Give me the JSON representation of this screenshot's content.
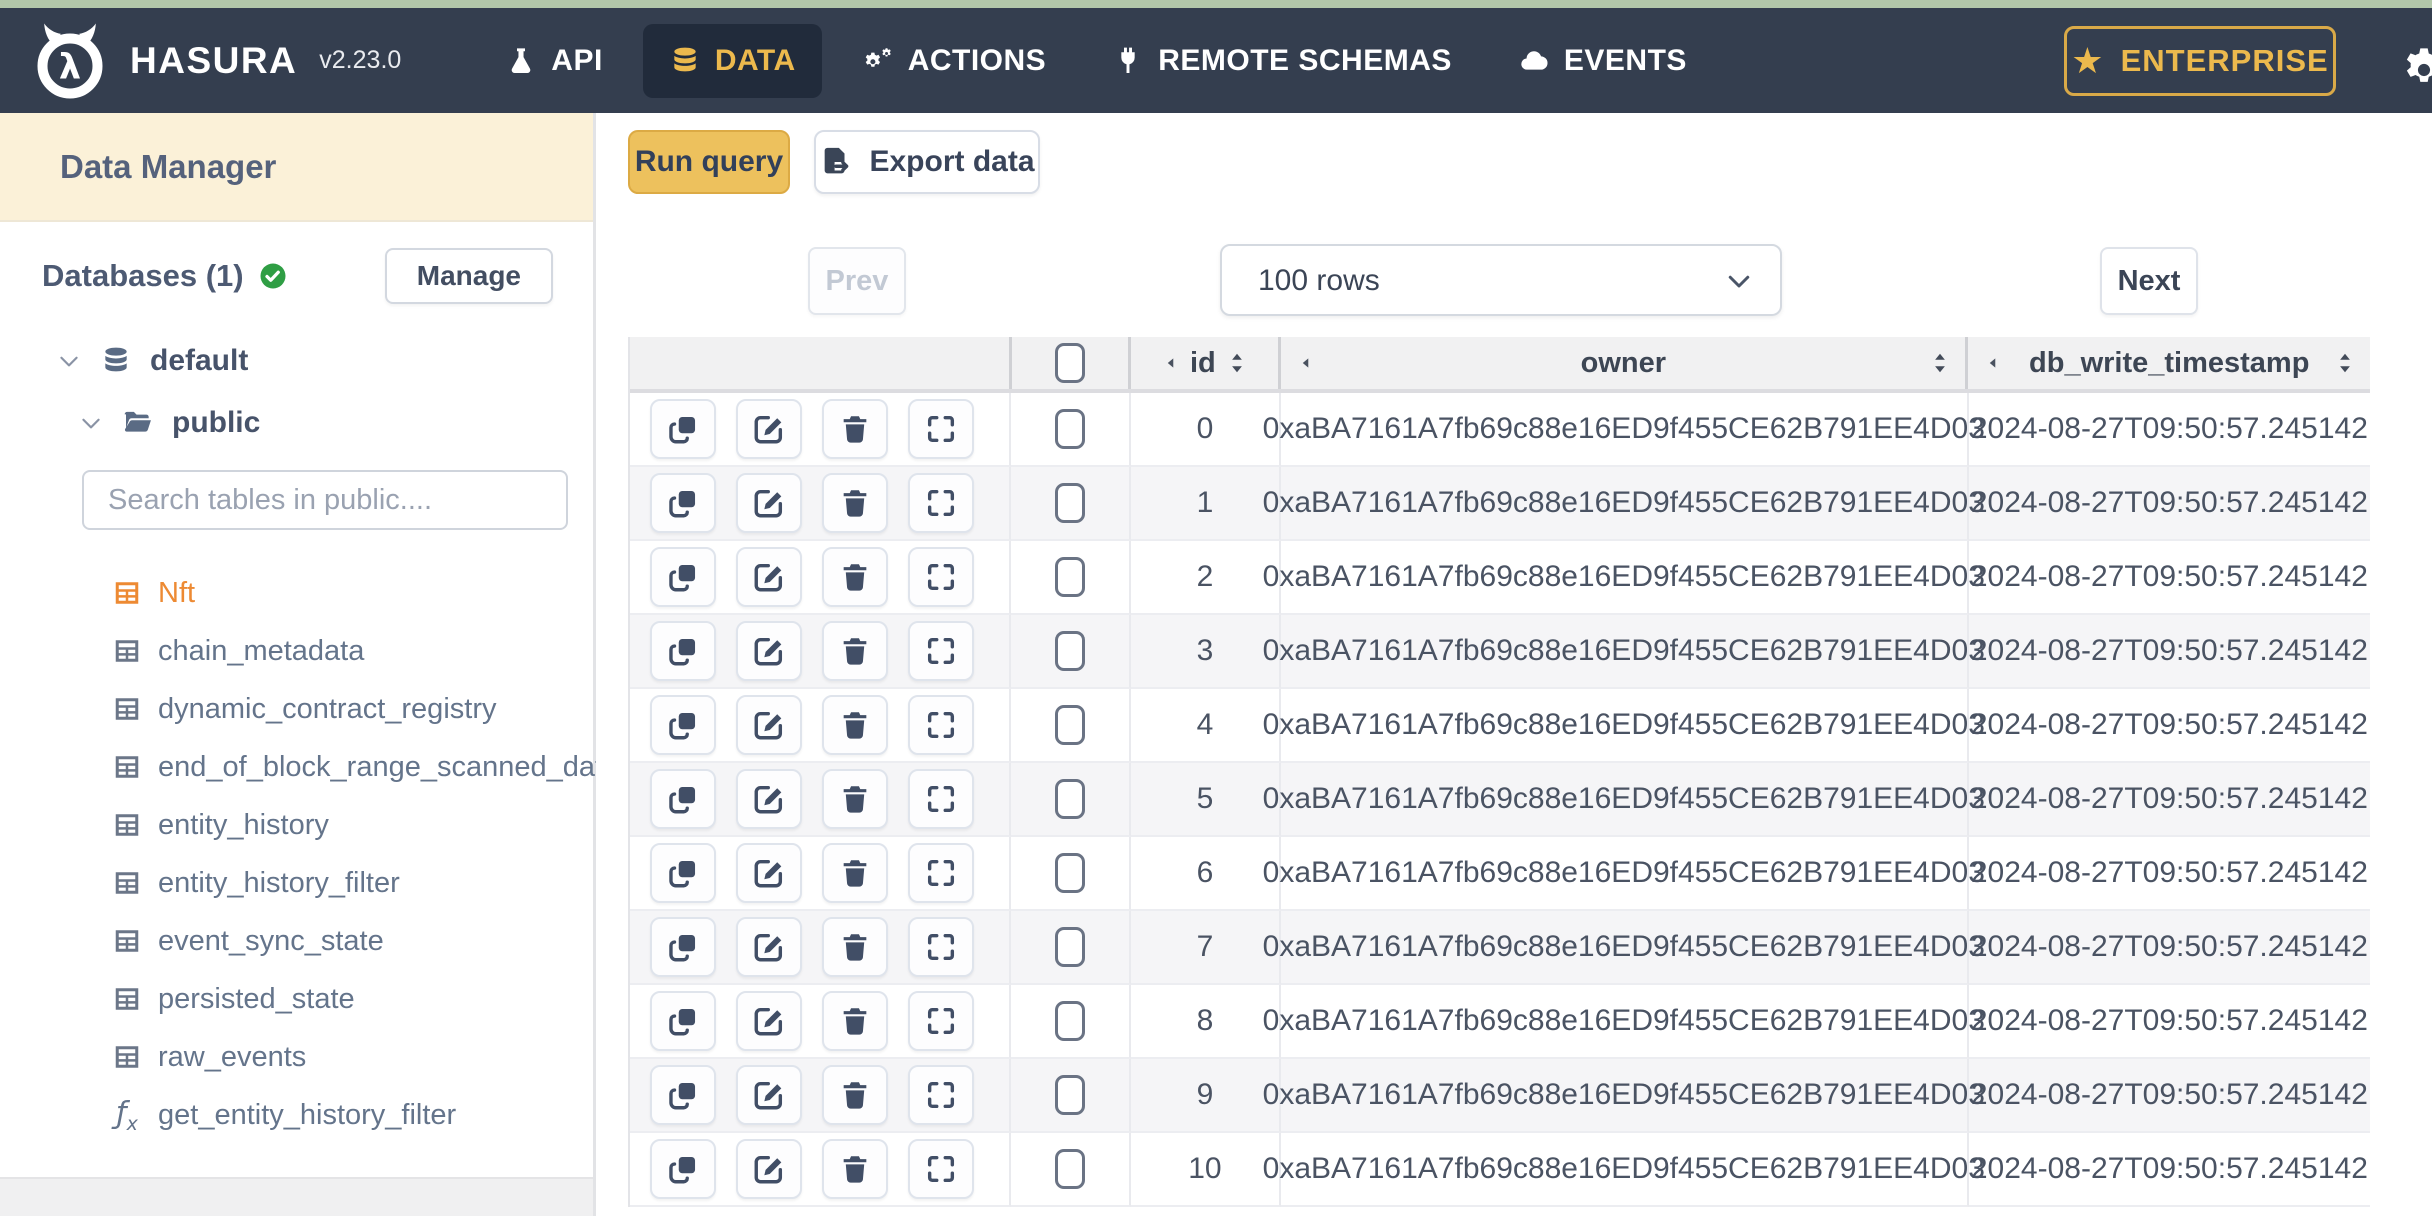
{
  "topbar": {
    "brand": "HASURA",
    "version": "v2.23.0",
    "nav": [
      {
        "label": "API",
        "icon": "flask-icon",
        "active": false
      },
      {
        "label": "DATA",
        "icon": "database-icon",
        "active": true
      },
      {
        "label": "ACTIONS",
        "icon": "gears-icon",
        "active": false
      },
      {
        "label": "REMOTE SCHEMAS",
        "icon": "plug-icon",
        "active": false
      },
      {
        "label": "EVENTS",
        "icon": "cloud-icon",
        "active": false
      }
    ],
    "enterprise_label": "ENTERPRISE"
  },
  "sidebar": {
    "title": "Data Manager",
    "databases_label": "Databases (1)",
    "manage_label": "Manage",
    "tree": {
      "database": "default",
      "schema": "public"
    },
    "search_placeholder": "Search tables in public....",
    "tables": [
      {
        "label": "Nft",
        "icon": "table-icon",
        "active": true
      },
      {
        "label": "chain_metadata",
        "icon": "table-icon",
        "active": false
      },
      {
        "label": "dynamic_contract_registry",
        "icon": "table-icon",
        "active": false
      },
      {
        "label": "end_of_block_range_scanned_data",
        "icon": "table-icon",
        "active": false
      },
      {
        "label": "entity_history",
        "icon": "table-icon",
        "active": false
      },
      {
        "label": "entity_history_filter",
        "icon": "table-icon",
        "active": false
      },
      {
        "label": "event_sync_state",
        "icon": "table-icon",
        "active": false
      },
      {
        "label": "persisted_state",
        "icon": "table-icon",
        "active": false
      },
      {
        "label": "raw_events",
        "icon": "table-icon",
        "active": false
      },
      {
        "label": "get_entity_history_filter",
        "icon": "function-icon",
        "active": false
      }
    ]
  },
  "toolbar": {
    "run_query_label": "Run query",
    "export_data_label": "Export data"
  },
  "pagination": {
    "prev_label": "Prev",
    "page_size": "100 rows",
    "next_label": "Next"
  },
  "table": {
    "columns": [
      "id",
      "owner",
      "db_write_timestamp"
    ],
    "rows": [
      {
        "id": "0",
        "owner": "0xaBA7161A7fb69c88e16ED9f455CE62B791EE4D03",
        "db_write_timestamp": "2024-08-27T09:50:57.245142"
      },
      {
        "id": "1",
        "owner": "0xaBA7161A7fb69c88e16ED9f455CE62B791EE4D03",
        "db_write_timestamp": "2024-08-27T09:50:57.245142"
      },
      {
        "id": "2",
        "owner": "0xaBA7161A7fb69c88e16ED9f455CE62B791EE4D03",
        "db_write_timestamp": "2024-08-27T09:50:57.245142"
      },
      {
        "id": "3",
        "owner": "0xaBA7161A7fb69c88e16ED9f455CE62B791EE4D03",
        "db_write_timestamp": "2024-08-27T09:50:57.245142"
      },
      {
        "id": "4",
        "owner": "0xaBA7161A7fb69c88e16ED9f455CE62B791EE4D03",
        "db_write_timestamp": "2024-08-27T09:50:57.245142"
      },
      {
        "id": "5",
        "owner": "0xaBA7161A7fb69c88e16ED9f455CE62B791EE4D03",
        "db_write_timestamp": "2024-08-27T09:50:57.245142"
      },
      {
        "id": "6",
        "owner": "0xaBA7161A7fb69c88e16ED9f455CE62B791EE4D03",
        "db_write_timestamp": "2024-08-27T09:50:57.245142"
      },
      {
        "id": "7",
        "owner": "0xaBA7161A7fb69c88e16ED9f455CE62B791EE4D03",
        "db_write_timestamp": "2024-08-27T09:50:57.245142"
      },
      {
        "id": "8",
        "owner": "0xaBA7161A7fb69c88e16ED9f455CE62B791EE4D03",
        "db_write_timestamp": "2024-08-27T09:50:57.245142"
      },
      {
        "id": "9",
        "owner": "0xaBA7161A7fb69c88e16ED9f455CE62B791EE4D03",
        "db_write_timestamp": "2024-08-27T09:50:57.245142"
      },
      {
        "id": "10",
        "owner": "0xaBA7161A7fb69c88e16ED9f455CE62B791EE4D03",
        "db_write_timestamp": "2024-08-27T09:50:57.245142"
      }
    ]
  },
  "colors": {
    "top_strip": "#b2c7aa",
    "navbar_bg": "#343e4f",
    "active_nav_bg": "#212b3b",
    "accent_gold": "#ecb94d",
    "run_query_bg": "#edc15d",
    "sidebar_band_bg": "#fbf1d8",
    "selected_table": "#ed8a33",
    "status_green": "#2f9e44"
  }
}
